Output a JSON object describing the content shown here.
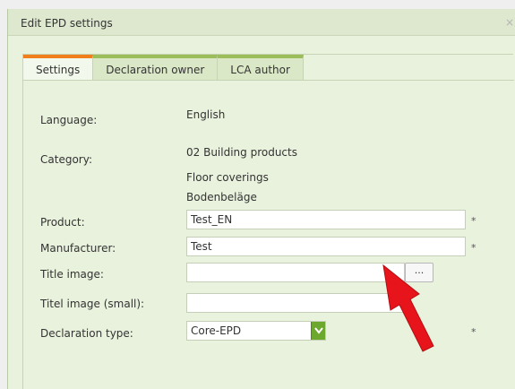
{
  "window": {
    "title": "Edit EPD settings",
    "close_glyph": "×"
  },
  "tabs": [
    {
      "label": "Settings",
      "active": true
    },
    {
      "label": "Declaration owner",
      "active": false
    },
    {
      "label": "LCA author",
      "active": false
    }
  ],
  "form": {
    "language_label": "Language:",
    "language_value": "English",
    "category_label": "Category:",
    "category_values": [
      "02 Building products",
      "Floor coverings",
      "Bodenbeläge"
    ],
    "product_label": "Product:",
    "product_value": "Test_EN",
    "manufacturer_label": "Manufacturer:",
    "manufacturer_value": "Test",
    "title_image_label": "Title image:",
    "title_image_value": "",
    "browse_label": "...",
    "title_image_small_label": "Titel image (small):",
    "title_image_small_value": "",
    "declaration_type_label": "Declaration type:",
    "declaration_type_value": "Core-EPD",
    "required_mark": "*"
  },
  "colors": {
    "dialog_bg": "#e9f2dd",
    "tab_active_accent": "#f07f1b",
    "tab_accent": "#9bbd5a",
    "select_button": "#6ca82e",
    "arrow": "#e8141b"
  },
  "icons": {
    "close": "close-icon",
    "dropdown": "chevron-down-icon",
    "pointer_arrow": "red-arrow-annotation"
  }
}
